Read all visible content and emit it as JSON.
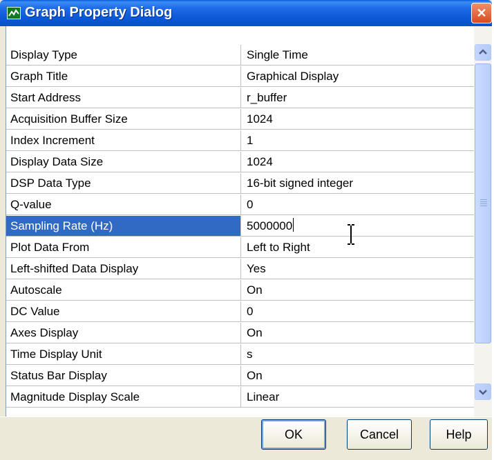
{
  "window": {
    "title": "Graph Property Dialog",
    "close_symbol": "✕"
  },
  "properties": [
    {
      "name": "Display Type",
      "value": "Single Time"
    },
    {
      "name": "Graph Title",
      "value": "Graphical Display"
    },
    {
      "name": "Start Address",
      "value": "r_buffer"
    },
    {
      "name": "Acquisition Buffer Size",
      "value": "1024"
    },
    {
      "name": "Index Increment",
      "value": "1"
    },
    {
      "name": "Display Data Size",
      "value": "1024"
    },
    {
      "name": "DSP Data Type",
      "value": "16-bit signed integer"
    },
    {
      "name": "Q-value",
      "value": "0"
    },
    {
      "name": "Sampling Rate (Hz)",
      "value": "5000000"
    },
    {
      "name": "Plot Data From",
      "value": "Left to Right"
    },
    {
      "name": "Left-shifted Data Display",
      "value": "Yes"
    },
    {
      "name": "Autoscale",
      "value": "On"
    },
    {
      "name": "DC Value",
      "value": "0"
    },
    {
      "name": "Axes Display",
      "value": "On"
    },
    {
      "name": "Time Display Unit",
      "value": "s"
    },
    {
      "name": "Status Bar Display",
      "value": "On"
    }
  ],
  "partial_row": {
    "name": "Magnitude Display Scale",
    "value": "Linear"
  },
  "selected_index": 8,
  "buttons": {
    "ok": "OK",
    "cancel": "Cancel",
    "help": "Help"
  },
  "colors": {
    "titlebar": "#0a5ddf",
    "selection": "#316ac5",
    "close": "#d94a1e"
  }
}
